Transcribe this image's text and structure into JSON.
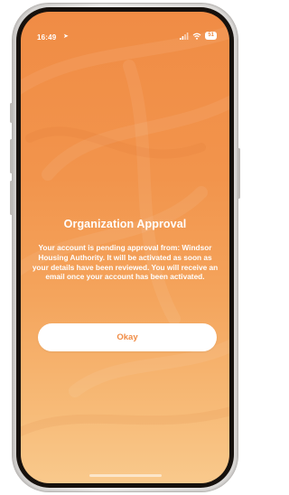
{
  "status_bar": {
    "time": "16:49",
    "location_icon": "location-arrow-icon",
    "signal_icon": "signal-bars-icon",
    "wifi_icon": "wifi-icon",
    "battery_level": "51"
  },
  "dialog": {
    "title": "Organization Approval",
    "message": "Your account is pending approval from: Windsor Housing Authority. It will be activated as soon as your details have been reviewed. You will receive an email once your account has been activated.",
    "okay_label": "Okay"
  },
  "colors": {
    "gradient_top": "#f08c45",
    "gradient_bottom": "#f9c98c",
    "button_text": "#f08c45",
    "button_bg": "#ffffff"
  }
}
